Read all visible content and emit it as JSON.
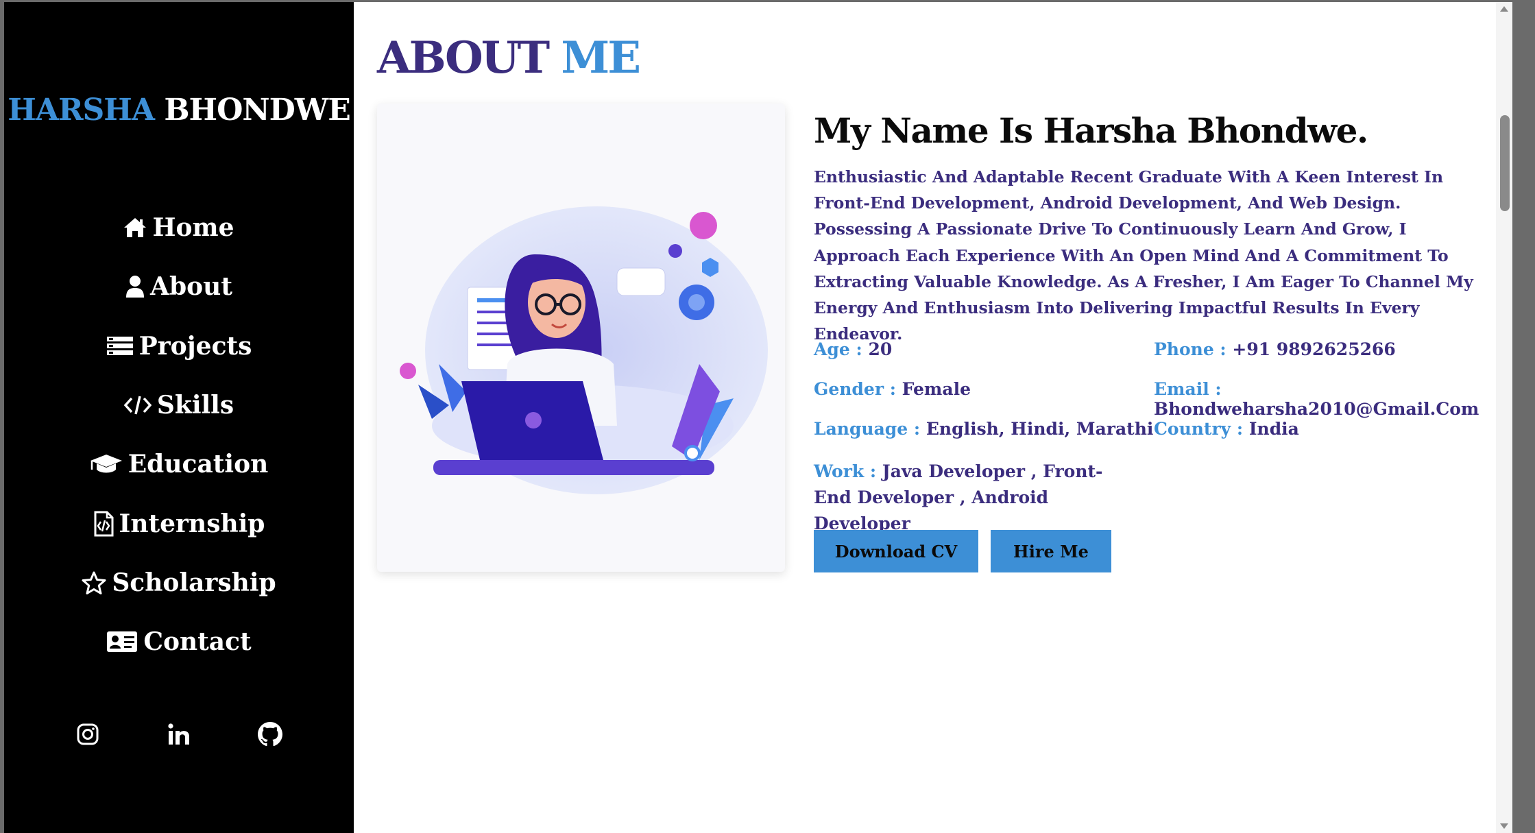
{
  "sidebar": {
    "brand_first": "HARSHA",
    "brand_last": "BHONDWE",
    "nav": [
      {
        "label": "Home",
        "icon": "home-icon"
      },
      {
        "label": "About",
        "icon": "user-icon"
      },
      {
        "label": "Projects",
        "icon": "list-icon"
      },
      {
        "label": "Skills",
        "icon": "code-icon"
      },
      {
        "label": "Education",
        "icon": "graduation-cap-icon"
      },
      {
        "label": "Internship",
        "icon": "code-file-icon"
      },
      {
        "label": "Scholarship",
        "icon": "star-icon"
      },
      {
        "label": "Contact",
        "icon": "id-card-icon"
      }
    ],
    "socials": [
      "instagram-icon",
      "linkedin-icon",
      "github-icon"
    ]
  },
  "main": {
    "heading_a": "ABOUT",
    "heading_b": "ME",
    "name": "My Name Is Harsha Bhondwe.",
    "bio": "Enthusiastic And Adaptable Recent Graduate With A Keen Interest In Front-End Development, Android Development, And Web Design. Possessing A Passionate Drive To Continuously Learn And Grow, I Approach Each Experience With An Open Mind And A Commitment To Extracting Valuable Knowledge. As A Fresher, I Am Eager To Channel My Energy And Enthusiasm Into Delivering Impactful Results In Every Endeavor.",
    "info": {
      "age_label": "Age :",
      "age": "20",
      "phone_label": "Phone :",
      "phone": "+91 9892625266",
      "gender_label": "Gender :",
      "gender": "Female",
      "email_label": "Email :",
      "email": "Bhondweharsha2010@Gmail.Com",
      "language_label": "Language :",
      "language": "English, Hindi, Marathi",
      "country_label": "Country :",
      "country": "India",
      "work_label": "Work :",
      "work": "Java Developer , Front-End Developer , Android Developer"
    },
    "buttons": {
      "download": "Download CV",
      "hire": "Hire Me"
    }
  },
  "colors": {
    "accent": "#3d8fd6",
    "primary_text": "#3b2d7e",
    "sidebar_bg": "#000000"
  }
}
